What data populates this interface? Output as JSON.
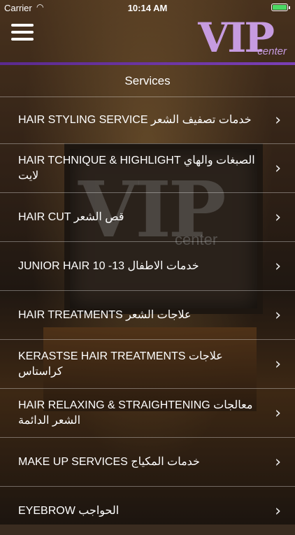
{
  "status_bar": {
    "carrier": "Carrier",
    "time": "10:14 AM",
    "battery_level_percent": 100
  },
  "header": {
    "brand_main": "VIP",
    "brand_sub": "center",
    "title": "Services",
    "menu_icon": "hamburger-icon"
  },
  "services": [
    {
      "label": "HAIR STYLING SERVICE  خدمات تصفيف الشعر"
    },
    {
      "label": "HAIR TCHNIQUE & HIGHLIGHT  الصبغات والهاي لايت"
    },
    {
      "label": "HAIR CUT قص الشعر"
    },
    {
      "label": "JUNIOR HAIR  10 -13 خدمات الاطفال"
    },
    {
      "label": "HAIR TREATMENTS  علاجات الشعر"
    },
    {
      "label": "KERASTSE HAIR TREATMENTS  علاجات كراستاس"
    },
    {
      "label": "HAIR RELAXING & STRAIGHTENING  معالجات الشعر الدائمة"
    },
    {
      "label": "MAKE UP SERVICES  خدمات المكياج"
    },
    {
      "label": "EYEBROW  الحواجب"
    }
  ],
  "colors": {
    "accent": "#7b3fb6",
    "brand": "#c69be0",
    "battery": "#4cd964"
  }
}
